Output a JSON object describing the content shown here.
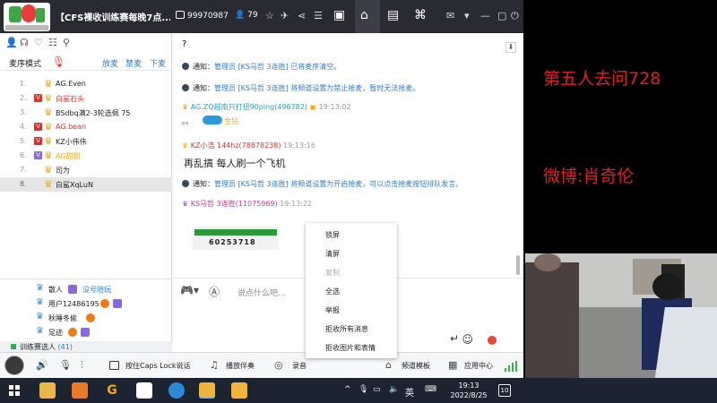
{
  "titlebar": {
    "title": "【CFS裸收训练赛每晚7点...",
    "room_id": "99970987",
    "viewers": "79"
  },
  "left": {
    "mode_label": "麦序模式",
    "actions": [
      "放麦",
      "禁麦",
      "下麦"
    ],
    "queue": [
      {
        "num": "1.",
        "name": "AG.Even",
        "badge": "",
        "color": "#222"
      },
      {
        "num": "2.",
        "name": "白鲨石头",
        "badge": "V",
        "color": "#d8342a"
      },
      {
        "num": "3.",
        "name": "BSdbq满2-3轮选佩 75",
        "badge": "",
        "color": "#222"
      },
      {
        "num": "4.",
        "name": "AG.bean",
        "badge": "V",
        "color": "#d8342a"
      },
      {
        "num": "5.",
        "name": "KZ小伟伟",
        "badge": "V",
        "color": "#222"
      },
      {
        "num": "6.",
        "name": "AG甜甜",
        "badge": "V",
        "color": "#f0a818"
      },
      {
        "num": "7.",
        "name": "司为",
        "badge": "",
        "color": "#222"
      },
      {
        "num": "8.",
        "name": "白鲨XqLuN",
        "badge": "",
        "color": "#222"
      }
    ],
    "audience": [
      {
        "name": "散人",
        "extra": "没号陪玩"
      },
      {
        "name": "用户12486195",
        "extra": ""
      },
      {
        "name": "秋睡冬偷",
        "extra": ""
      },
      {
        "name": "足迹",
        "extra": ""
      }
    ],
    "train_label": "训练赛选人",
    "train_count": "(41)"
  },
  "chat": {
    "top_mark": "?",
    "notices": [
      {
        "prefix": "通知：",
        "role": "管理员",
        "who": "[KS马哲 3连胜]",
        "text": "已将麦序清空。"
      },
      {
        "prefix": "通知：",
        "role": "管理员",
        "who": "[KS马哲 3连胜]",
        "text": "将频道设置为禁止抢麦，暂时无法抢麦。"
      }
    ],
    "msg1_user": "AG.ZQ越南只打扭90ping(496782)",
    "msg1_time": "19:13:02",
    "msg1_text": "。。",
    "msg1_tag": "金钻",
    "msg2_user": "KZ小浩 144hz(78878238)",
    "msg2_time": "19:13:16",
    "msg2_text": "再乱搞 每人刷一个飞机",
    "notice3": {
      "prefix": "通知：",
      "role": "管理员",
      "who": "[KS马哲 3连胜]",
      "text": "将频道设置为开启抢麦，可以点击抢麦按钮排队发言。"
    },
    "msg3_user": "KS马哲 3连胜(11075969)",
    "msg3_time": "19:13:22",
    "gift_number": "60253718"
  },
  "input": {
    "placeholder": "说点什么吧..."
  },
  "context_menu": [
    {
      "label": "锁屏",
      "disabled": false
    },
    {
      "label": "清屏",
      "disabled": false
    },
    {
      "label": "复制",
      "disabled": true
    },
    {
      "label": "全选",
      "disabled": false
    },
    {
      "label": "举报",
      "disabled": false
    },
    {
      "label": "拒收所有消息",
      "disabled": false
    },
    {
      "label": "拒收图片和表情",
      "disabled": false
    }
  ],
  "toolbar": {
    "caps_label": "按住Caps Lock说话",
    "accompany_label": "播放伴奏",
    "record_label": "录音",
    "template_label": "频道模板",
    "app_center_label": "应用中心"
  },
  "overlay": {
    "line1": "第五人去问728",
    "line2": "微博:肖奇伦"
  },
  "taskbar": {
    "ime": "英",
    "time": "19:13",
    "date": "2022/8/25",
    "notif_count": "10"
  }
}
